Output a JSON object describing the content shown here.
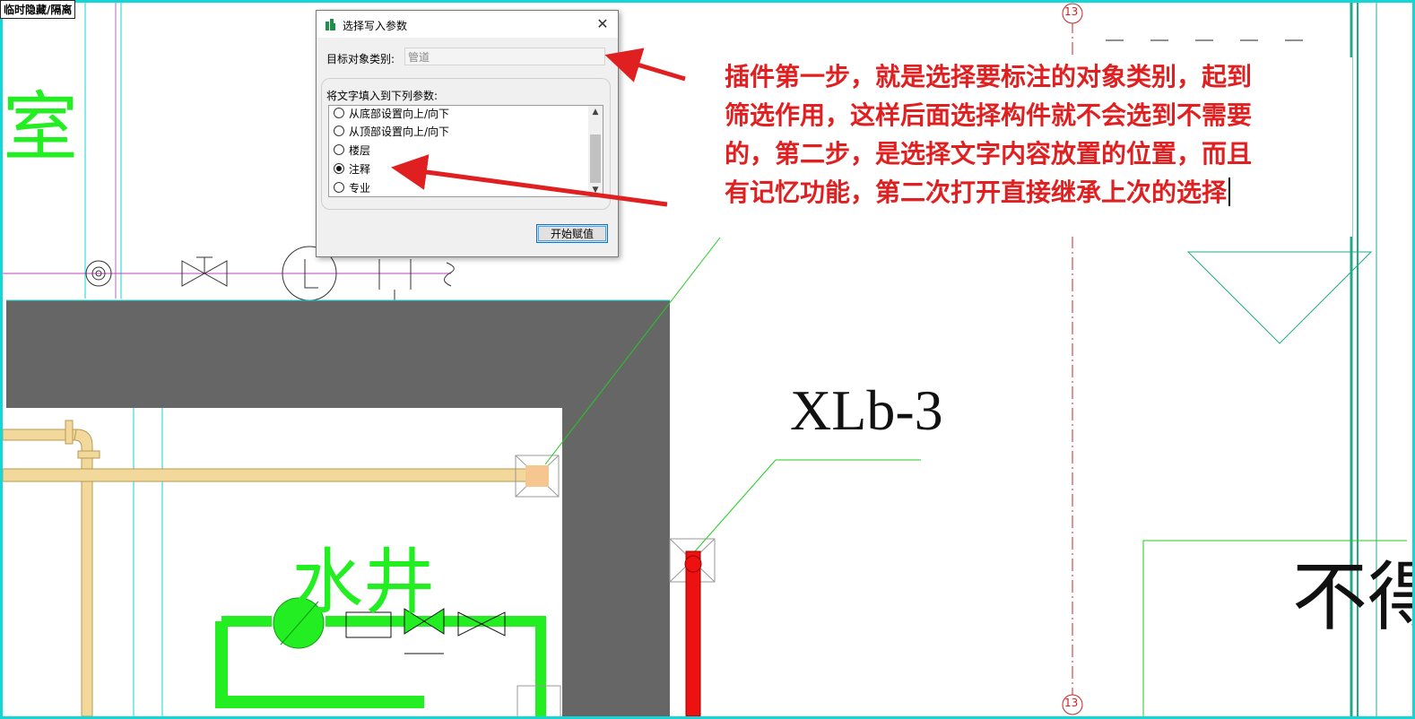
{
  "mode_tag": "临时隐藏/隔离",
  "drawing": {
    "axis_marker": "13",
    "room_text": "室",
    "shaft_label": "水井",
    "pipe_tag": "XLb-3",
    "note_text": "不得"
  },
  "dialog": {
    "title": "选择写入参数",
    "target_label": "目标对象类别:",
    "target_value": "管道",
    "fill_label": "将文字填入到下列参数:",
    "options": [
      {
        "label": "从底部设置向上/向下",
        "checked": false
      },
      {
        "label": "从顶部设置向上/向下",
        "checked": false
      },
      {
        "label": "楼层",
        "checked": false
      },
      {
        "label": "注释",
        "checked": true
      },
      {
        "label": "专业",
        "checked": false
      }
    ],
    "start_button": "开始赋值",
    "close_glyph": "✕"
  },
  "annotation": {
    "lines": [
      "插件第一步，就是选择要标注的对象类别，起到",
      "筛选作用，这样后面选择构件就不会选到不需要",
      "的，第二步，是选择文字内容放置的位置，而且",
      "有记忆功能，第二次打开直接继承上次的选择"
    ],
    "color": "#e02020"
  },
  "colors": {
    "frame": "#14d6d6",
    "wall": "#666666",
    "water_pipe": "#22ee22",
    "beige_pipe": "#f2d89a",
    "red_pipe": "#ee1111",
    "grid_line": "#cc2222"
  }
}
